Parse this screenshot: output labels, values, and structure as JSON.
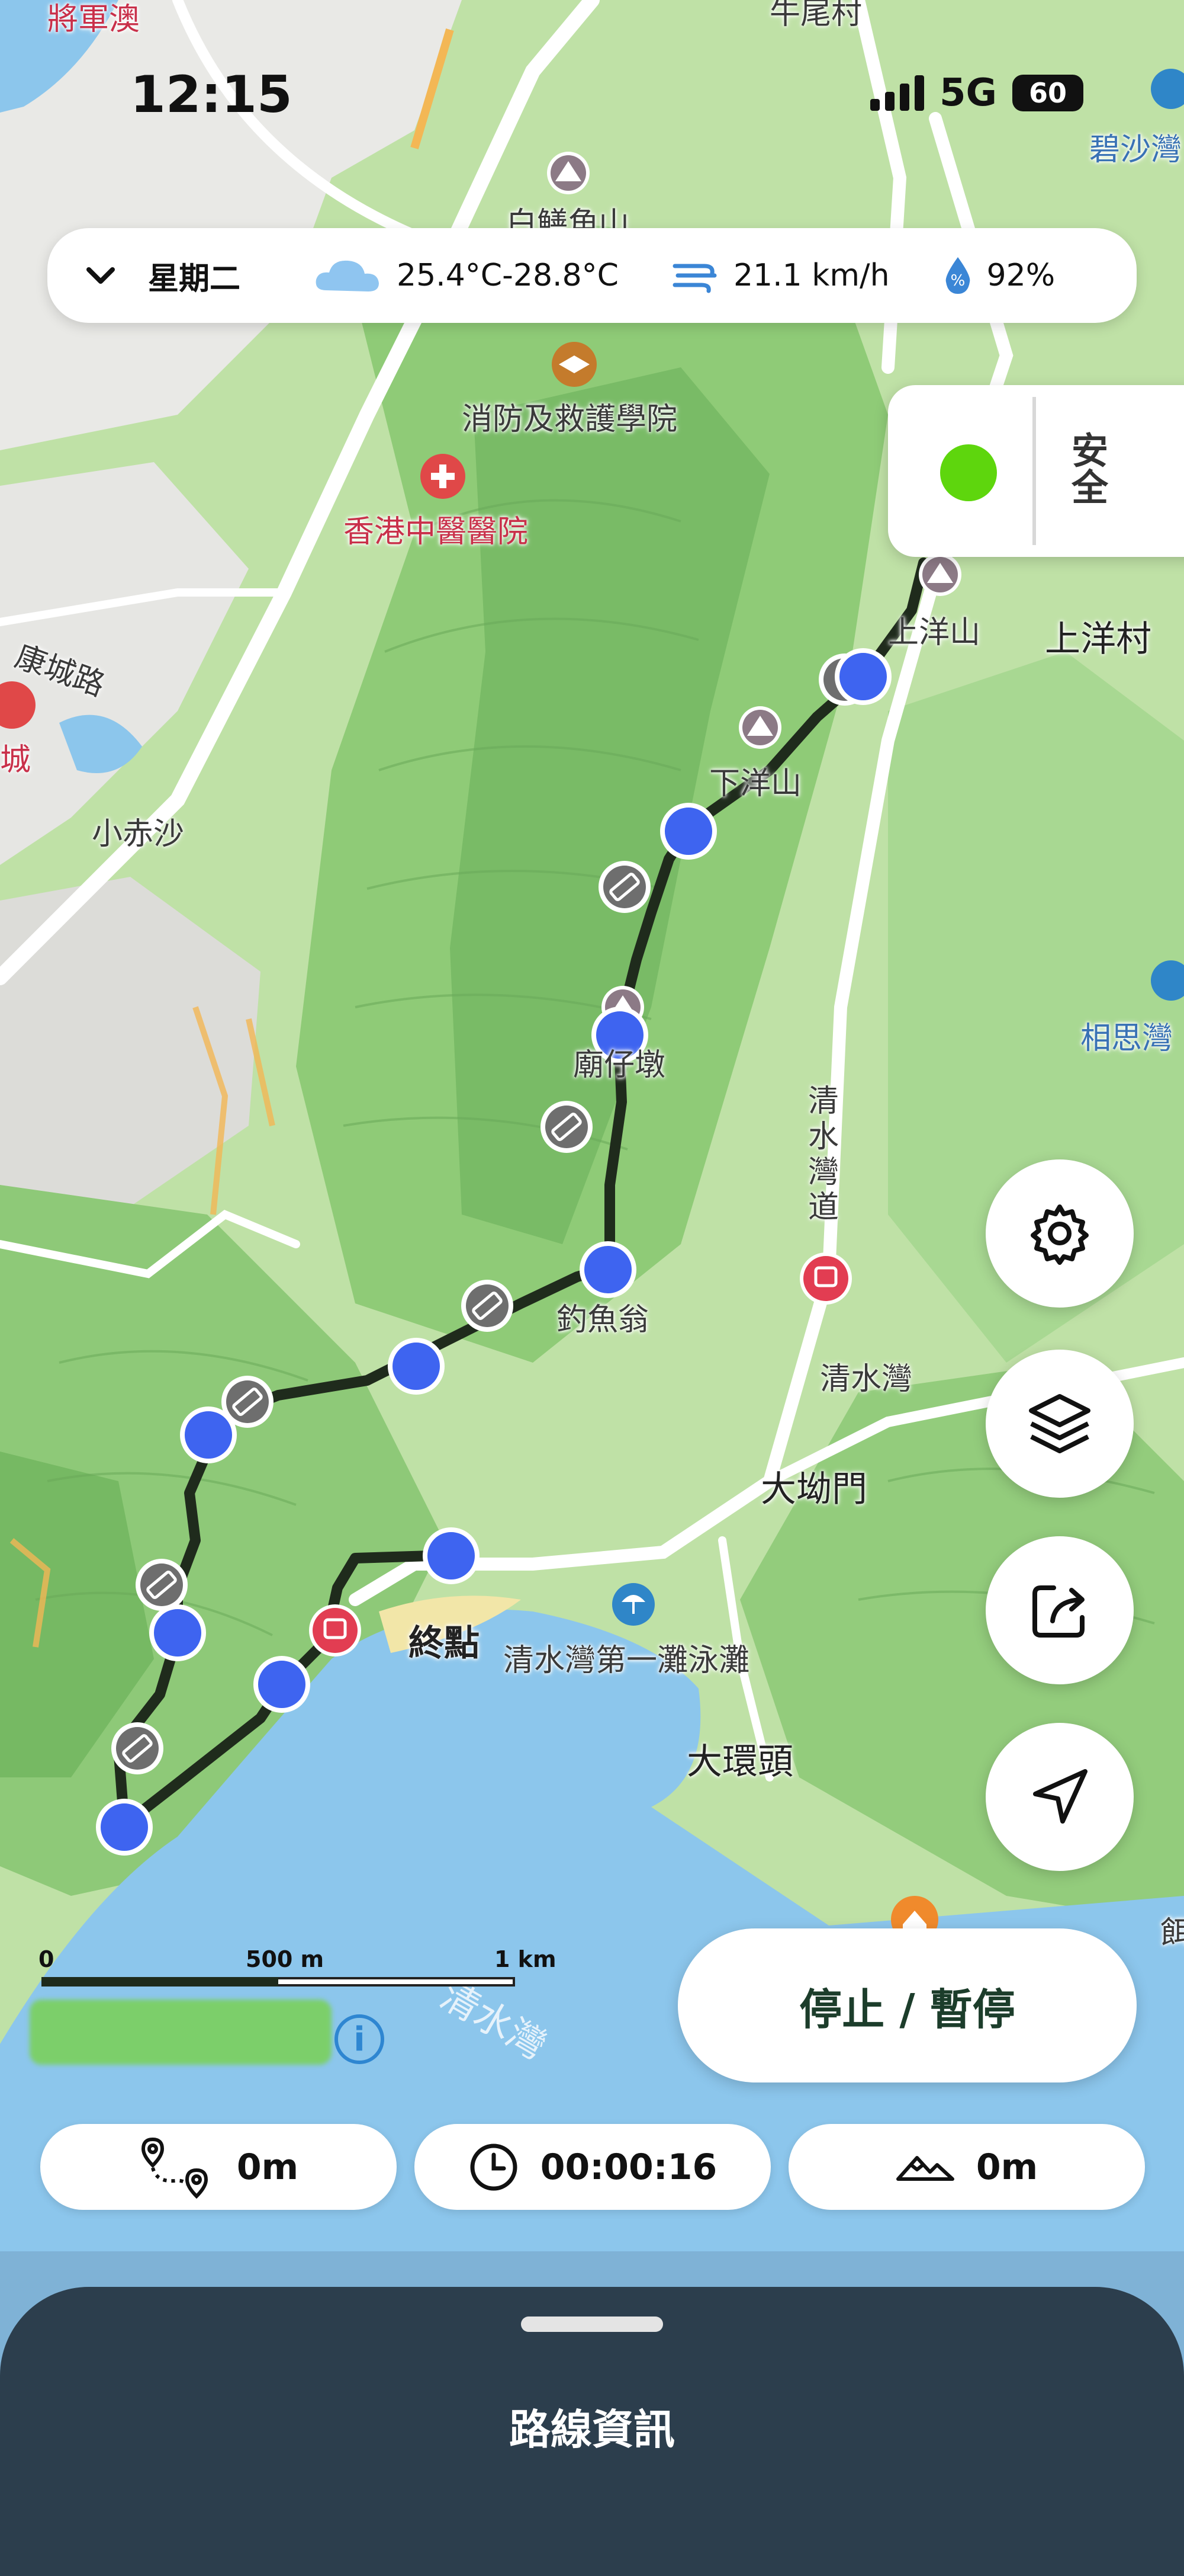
{
  "status_bar": {
    "time": "12:15",
    "network": "5G",
    "battery": "60"
  },
  "weather_bar": {
    "day": "星期二",
    "temperature": "25.4°C-28.8°C",
    "wind": "21.1 km/h",
    "humidity": "92%"
  },
  "safety_badge": {
    "label": "安全",
    "status_color": "#5ed60d"
  },
  "map": {
    "labels": {
      "jiangjunao": "將軍澳",
      "ngau_pui": "牛尾村",
      "bisha_wan": "碧沙灣",
      "peak_white": "白鱔角山",
      "fire_academy": "消防及救護學院",
      "cm_hospital": "香港中醫醫院",
      "hong_shing_rd": "康城路",
      "city": "城",
      "siu_chik_sha": "小赤沙",
      "sheung_yeung_shan": "上洋山",
      "sheung_yeung_village": "上洋村",
      "ha_yeung_shan": "下洋山",
      "miu_tsai_tun": "廟仔墩",
      "seung_sze_wan": "相思灣",
      "clear_water_bay_road": "清水灣道",
      "tiu_yue_yung": "釣魚翁",
      "clear_water_bay": "清水灣",
      "tai_au_mun": "大坳門",
      "end_point": "終點",
      "first_beach": "清水灣第一灘泳灘",
      "tai_wan_tau": "大環頭",
      "bay_water": "清水灣",
      "edge_right": "餌"
    },
    "scale_labels": [
      "0",
      "500 m",
      "1 km"
    ]
  },
  "stop_button": {
    "label": "停止 / 暫停"
  },
  "stats": {
    "distance": "0m",
    "duration": "00:00:16",
    "elevation": "0m"
  },
  "bottom_panel": {
    "title": "路線資訊"
  },
  "icons": {
    "chevron": "chevron-down-icon",
    "cloud": "cloud-icon",
    "wind": "wind-icon",
    "humidity": "humidity-icon",
    "settings": "gear-icon",
    "layers": "layers-icon",
    "share": "share-icon",
    "locate": "navigation-arrow-icon",
    "info": "info-icon",
    "route": "route-icon",
    "clock": "clock-icon",
    "mountain": "mountain-icon"
  },
  "colors": {
    "accent": "#1c3d2b",
    "safe": "#5ed60d",
    "panel": "#2c3e4d",
    "waypoint": "#3e64f0"
  }
}
